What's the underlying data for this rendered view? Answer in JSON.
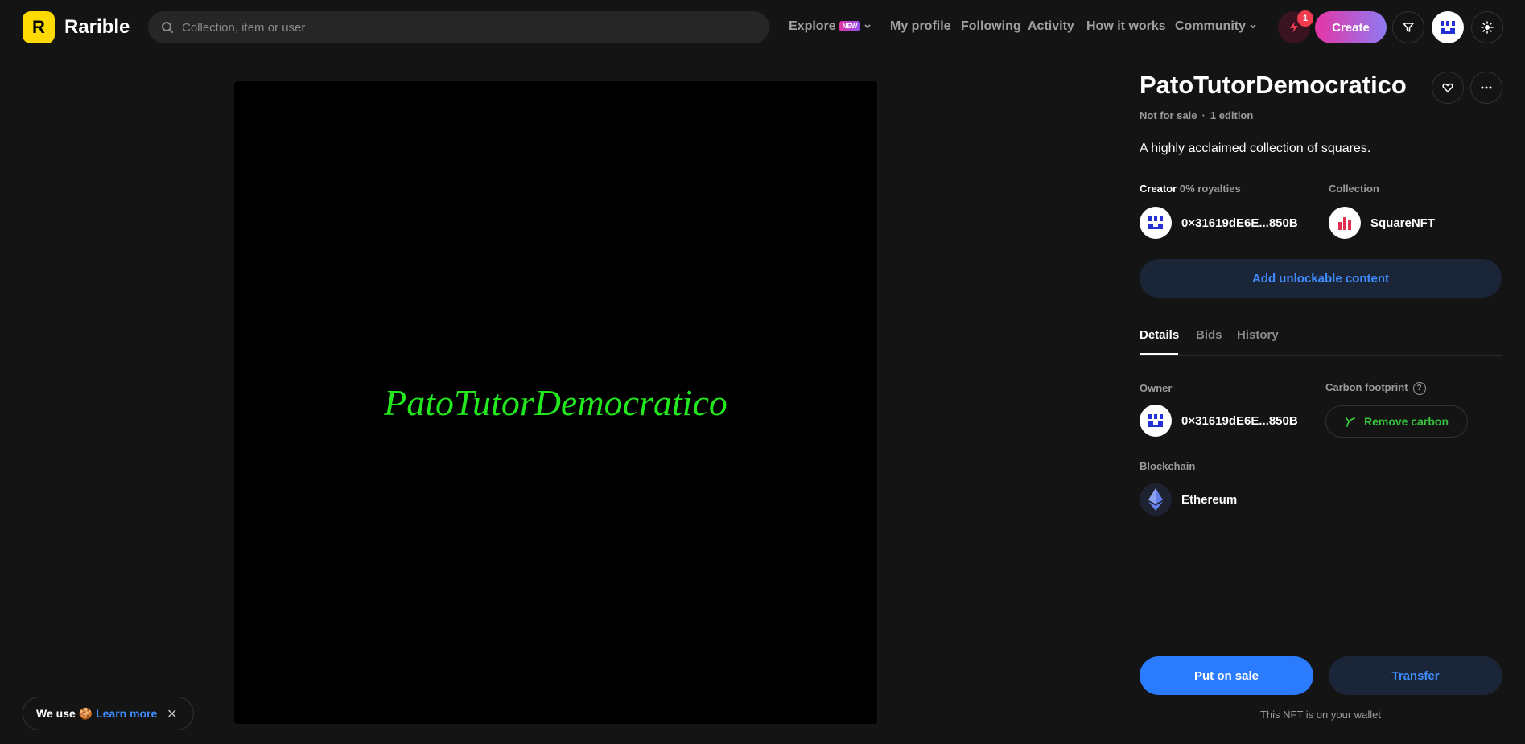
{
  "header": {
    "logo_letter": "R",
    "brand": "Rarible",
    "search_placeholder": "Collection, item or user",
    "nav": {
      "explore": "Explore",
      "explore_badge": "NEW",
      "my_profile": "My profile",
      "following": "Following",
      "activity": "Activity",
      "how_it_works": "How it works",
      "community": "Community"
    },
    "notification_count": "1",
    "create_label": "Create"
  },
  "artwork": {
    "text": "PatoTutorDemocratico",
    "text_color": "#22e91e"
  },
  "item": {
    "title": "PatoTutorDemocratico",
    "status": "Not for sale",
    "separator": "·",
    "editions": "1 edition",
    "description": "A highly acclaimed collection of squares.",
    "creator_label": "Creator",
    "royalties": "0% royalties",
    "creator_name": "0×31619dE6E...850B",
    "collection_label": "Collection",
    "collection_name": "SquareNFT",
    "unlockable_label": "Add unlockable content"
  },
  "tabs": {
    "details": "Details",
    "bids": "Bids",
    "history": "History"
  },
  "details": {
    "owner_label": "Owner",
    "owner_name": "0×31619dE6E...850B",
    "carbon_label": "Carbon footprint",
    "carbon_help": "?",
    "carbon_button": "Remove carbon",
    "blockchain_label": "Blockchain",
    "blockchain_name": "Ethereum"
  },
  "actions": {
    "put_on_sale": "Put on sale",
    "transfer": "Transfer",
    "wallet_note": "This NFT is on your wallet"
  },
  "cookie": {
    "text": "We use",
    "emoji": "🍪",
    "learn_more": "Learn more",
    "close": "✕"
  },
  "colors": {
    "brand_yellow": "#FEDA03",
    "accent_blue": "#2b7bff",
    "carbon_green": "#35c23a"
  }
}
